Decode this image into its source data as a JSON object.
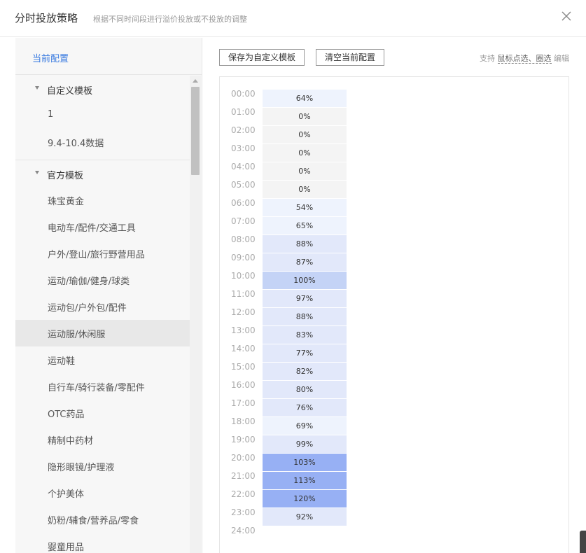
{
  "header": {
    "title": "分时投放策略",
    "subtitle": "根据不同时间段进行溢价投放或不投放的调整"
  },
  "sidebar": {
    "current_config": "当前配置",
    "groups": [
      {
        "label": "自定义模板",
        "items": [
          "1",
          "9.4-10.4数据"
        ]
      },
      {
        "label": "官方模板",
        "items": [
          "珠宝黄金",
          "电动车/配件/交通工具",
          "户外/登山/旅行野营用品",
          "运动/瑜伽/健身/球类",
          "运动包/户外包/配件",
          "运动服/休闲服",
          "运动鞋",
          "自行车/骑行装备/零配件",
          "OTC药品",
          "精制中药材",
          "隐形眼镜/护理液",
          "个护美体",
          "奶粉/辅食/营养品/零食",
          "婴童用品"
        ]
      }
    ]
  },
  "toolbar": {
    "save_template": "保存为自定义模板",
    "clear_config": "清空当前配置",
    "help_prefix": "支持",
    "help_methods": "鼠标点选、圈选",
    "help_suffix": "编辑"
  },
  "schedule": {
    "hours": [
      "00:00",
      "01:00",
      "02:00",
      "03:00",
      "04:00",
      "05:00",
      "06:00",
      "07:00",
      "08:00",
      "09:00",
      "10:00",
      "11:00",
      "12:00",
      "13:00",
      "14:00",
      "15:00",
      "16:00",
      "17:00",
      "18:00",
      "19:00",
      "20:00",
      "21:00",
      "22:00",
      "23:00",
      "24:00"
    ],
    "values": [
      "64%",
      "0%",
      "0%",
      "0%",
      "0%",
      "0%",
      "54%",
      "65%",
      "88%",
      "87%",
      "100%",
      "97%",
      "88%",
      "83%",
      "77%",
      "82%",
      "80%",
      "76%",
      "69%",
      "99%",
      "103%",
      "113%",
      "120%",
      "92%"
    ]
  },
  "colors": {
    "zero": "#f4f4f4",
    "low": "#eef3fd",
    "mid": "#e2e8fa",
    "full": "#c4d3f6",
    "high": "#97b0f4",
    "accent": "#3a7be0"
  }
}
